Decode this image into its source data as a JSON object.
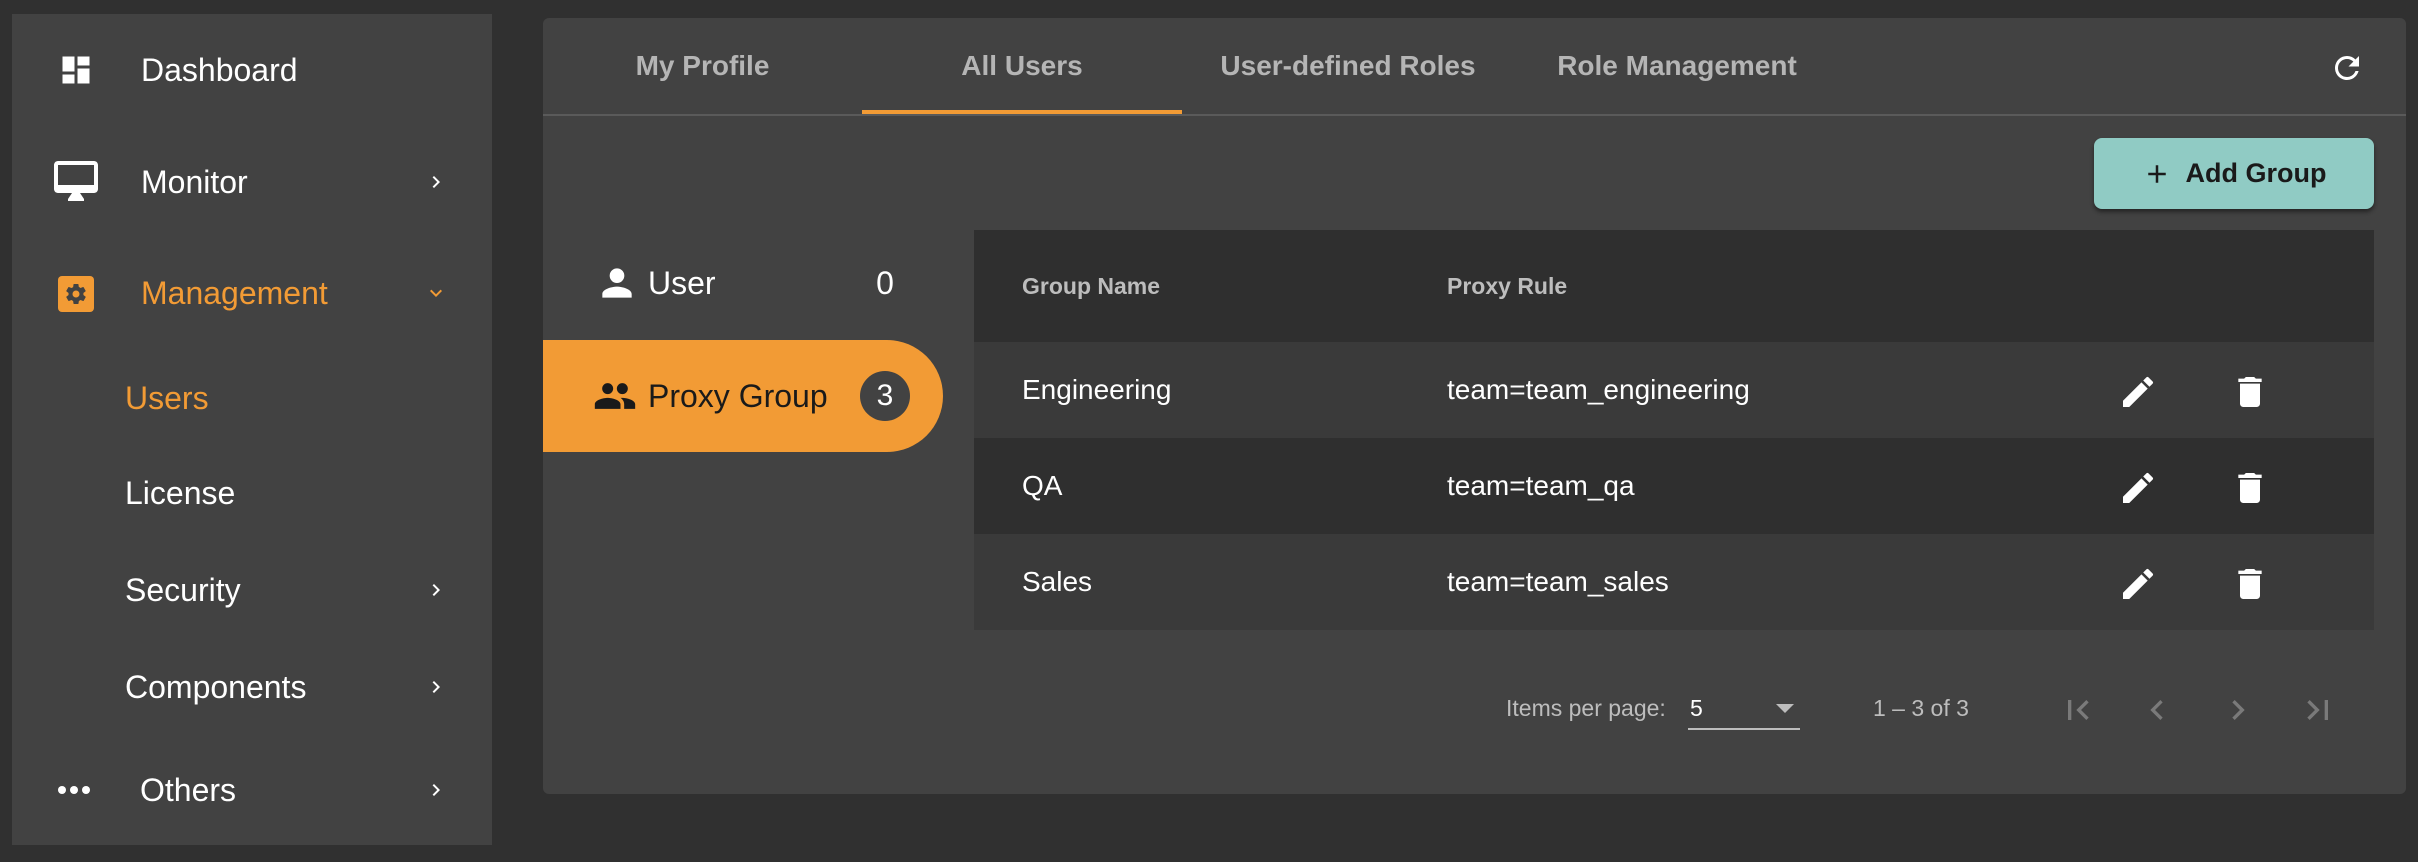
{
  "sidebar": {
    "items": [
      {
        "label": "Dashboard",
        "icon": "dashboard-icon"
      },
      {
        "label": "Monitor",
        "icon": "monitor-icon",
        "chevron": "chevron-right-icon"
      },
      {
        "label": "Management",
        "icon": "gear-icon",
        "chevron": "chevron-down-icon",
        "active": true
      },
      {
        "label": "Users",
        "sub": true,
        "active": true
      },
      {
        "label": "License",
        "sub": true
      },
      {
        "label": "Security",
        "sub": true,
        "chevron": "chevron-right-icon"
      },
      {
        "label": "Components",
        "sub": true,
        "chevron": "chevron-right-icon"
      },
      {
        "label": "Others",
        "icon": "more-horiz-icon",
        "chevron": "chevron-right-icon"
      }
    ]
  },
  "tabs": [
    {
      "label": "My Profile"
    },
    {
      "label": "All Users",
      "active": true
    },
    {
      "label": "User-defined Roles"
    },
    {
      "label": "Role Management"
    }
  ],
  "toolbar": {
    "refresh_icon": "refresh-icon",
    "add_group_label": "Add Group"
  },
  "entity_list": [
    {
      "label": "User",
      "count": "0",
      "icon": "person-icon"
    },
    {
      "label": "Proxy Group",
      "count": "3",
      "icon": "group-icon",
      "active": true
    }
  ],
  "table": {
    "columns": [
      "Group Name",
      "Proxy Rule"
    ],
    "rows": [
      {
        "group_name": "Engineering",
        "proxy_rule": "team=team_engineering"
      },
      {
        "group_name": "QA",
        "proxy_rule": "team=team_qa"
      },
      {
        "group_name": "Sales",
        "proxy_rule": "team=team_sales"
      }
    ]
  },
  "paginator": {
    "items_per_page_label": "Items per page:",
    "items_per_page_value": "5",
    "range_label": "1 – 3 of 3"
  },
  "colors": {
    "accent": "#f29b35",
    "primary_button": "#90cbc4",
    "surface": "#424242",
    "background": "#303030"
  }
}
